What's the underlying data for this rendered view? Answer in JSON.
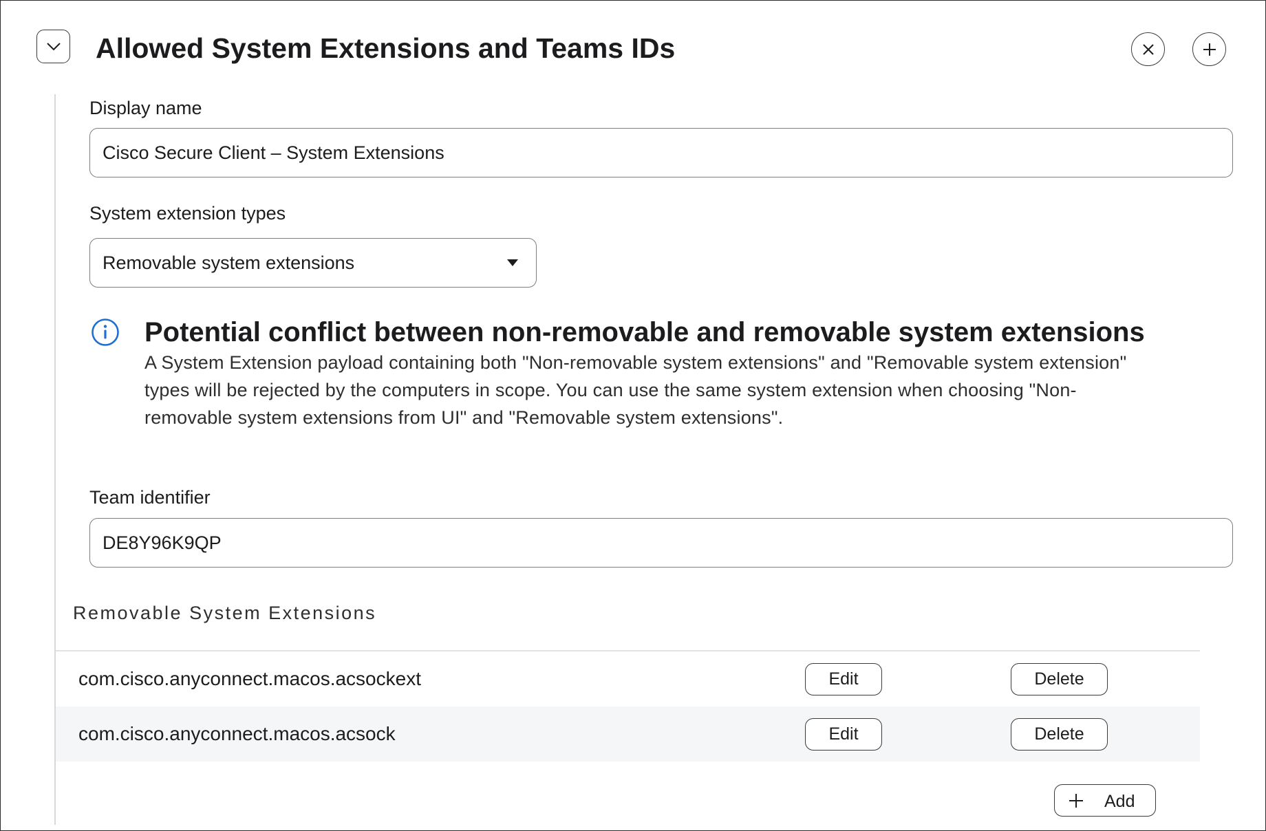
{
  "header": {
    "title": "Allowed System Extensions and Teams IDs",
    "collapse_icon": "chevron-down-icon",
    "close_icon": "close-icon",
    "add_icon": "plus-icon"
  },
  "form": {
    "display_name": {
      "label": "Display name",
      "value": "Cisco Secure Client – System Extensions"
    },
    "extension_types": {
      "label": "System extension types",
      "selected": "Removable system extensions"
    },
    "team_identifier": {
      "label": "Team identifier",
      "value": "DE8Y96K9QP"
    }
  },
  "notice": {
    "icon": "info-icon",
    "title": "Potential conflict between non-removable and removable system extensions",
    "body_lines": [
      "A System Extension payload containing both \"Non-removable system extensions\" and \"Removable system extension\"",
      "types will be rejected by the computers in scope. You can use the same system extension when choosing \"Non-",
      "removable system extensions from UI\" and \"Removable system extensions\"."
    ],
    "accent_color": "#1f6fd1"
  },
  "extensions": {
    "heading": "Removable System Extensions",
    "rows": [
      {
        "name": "com.cisco.anyconnect.macos.acsockext",
        "edit_label": "Edit",
        "delete_label": "Delete"
      },
      {
        "name": "com.cisco.anyconnect.macos.acsock",
        "edit_label": "Edit",
        "delete_label": "Delete"
      }
    ],
    "add_label": "Add"
  }
}
